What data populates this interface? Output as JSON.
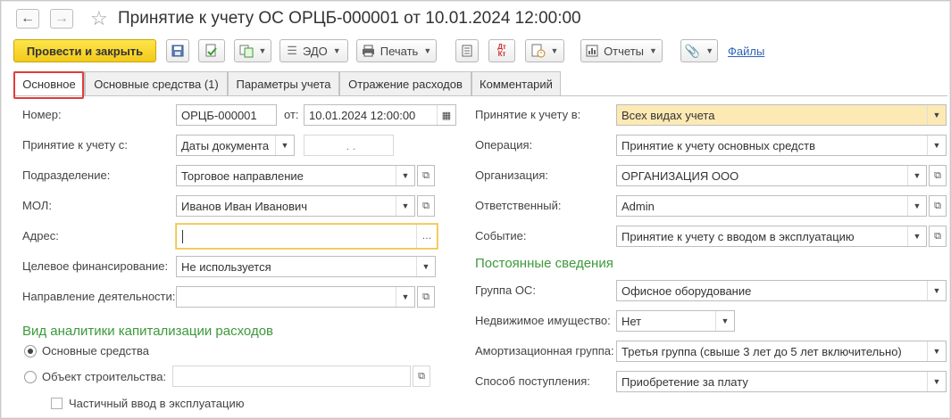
{
  "window": {
    "title": "Принятие к учету ОС ОРЦБ-000001 от 10.01.2024 12:00:00"
  },
  "toolbar": {
    "post_close": "Провести и закрыть",
    "edo": "ЭДО",
    "print": "Печать",
    "reports": "Отчеты",
    "files": "Файлы"
  },
  "tabs": [
    {
      "label": "Основное"
    },
    {
      "label": "Основные средства (1)"
    },
    {
      "label": "Параметры учета"
    },
    {
      "label": "Отражение расходов"
    },
    {
      "label": "Комментарий"
    }
  ],
  "left": {
    "number_label": "Номер:",
    "number_value": "ОРЦБ-000001",
    "date_label": "от:",
    "date_value": "10.01.2024 12:00:00",
    "accept_from_label": "Принятие к учету с:",
    "accept_from_value": "Даты документа",
    "accept_from_date": ". .",
    "division_label": "Подразделение:",
    "division_value": "Торговое направление",
    "mol_label": "МОЛ:",
    "mol_value": "Иванов Иван Иванович",
    "address_label": "Адрес:",
    "address_value": "",
    "financing_label": "Целевое финансирование:",
    "financing_value": "Не используется",
    "direction_label": "Направление деятельности:",
    "direction_value": "",
    "section_title": "Вид аналитики капитализации расходов",
    "radio_os": "Основные средства",
    "radio_construction": "Объект строительства:",
    "construction_value": "",
    "partial_label": "Частичный ввод в эксплуатацию"
  },
  "right": {
    "accept_in_label": "Принятие к учету в:",
    "accept_in_value": "Всех видах учета",
    "operation_label": "Операция:",
    "operation_value": "Принятие к учету основных средств",
    "org_label": "Организация:",
    "org_value": "ОРГАНИЗАЦИЯ ООО",
    "resp_label": "Ответственный:",
    "resp_value": "Admin",
    "event_label": "Событие:",
    "event_value": "Принятие к учету с вводом в эксплуатацию",
    "section_title": "Постоянные сведения",
    "group_label": "Группа ОС:",
    "group_value": "Офисное оборудование",
    "realty_label": "Недвижимое имущество:",
    "realty_value": "Нет",
    "amort_label": "Амортизационная группа:",
    "amort_value": "Третья группа (свыше 3 лет до 5 лет включительно)",
    "method_label": "Способ поступления:",
    "method_value": "Приобретение за плату"
  },
  "colors": {
    "accent_green": "#3b9a3b",
    "highlight_red": "#e03c3c",
    "primary_yellow": "#f2c91b"
  }
}
